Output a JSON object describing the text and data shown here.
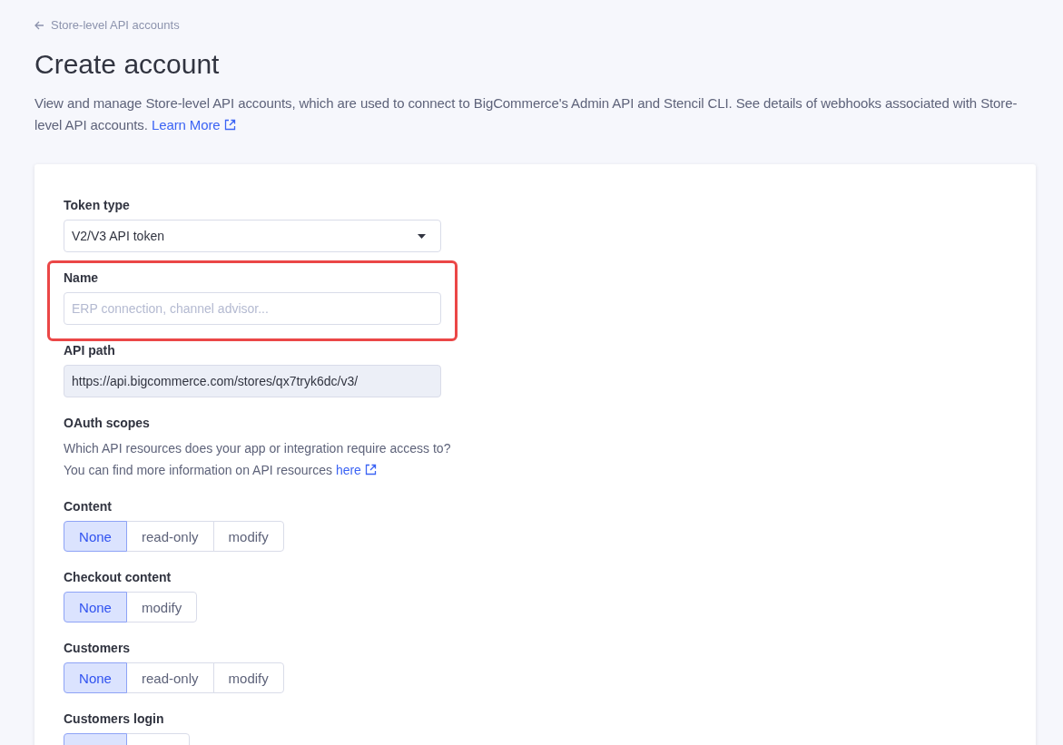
{
  "breadcrumb": {
    "label": "Store-level API accounts"
  },
  "title": "Create account",
  "description": {
    "text": "View and manage Store-level API accounts, which are used to connect to BigCommerce's Admin API and Stencil CLI. See details of webhooks associated with Store-level API accounts.",
    "link": "Learn More"
  },
  "token_type": {
    "label": "Token type",
    "value": "V2/V3 API token"
  },
  "name": {
    "label": "Name",
    "placeholder": "ERP connection, channel advisor...",
    "highlighted": true
  },
  "api_path": {
    "label": "API path",
    "value": "https://api.bigcommerce.com/stores/qx7tryk6dc/v3/"
  },
  "oauth": {
    "label": "OAuth scopes",
    "help": "Which API resources does your app or integration require access to?",
    "help_2": "You can find more information on API resources",
    "link": "here"
  },
  "scopes": [
    {
      "label": "Content",
      "options": [
        {
          "label": "None",
          "selected": true
        },
        {
          "label": "read-only",
          "selected": false
        },
        {
          "label": "modify",
          "selected": false
        }
      ]
    },
    {
      "label": "Checkout content",
      "options": [
        {
          "label": "None",
          "selected": true
        },
        {
          "label": "modify",
          "selected": false
        }
      ]
    },
    {
      "label": "Customers",
      "options": [
        {
          "label": "None",
          "selected": true
        },
        {
          "label": "read-only",
          "selected": false
        },
        {
          "label": "modify",
          "selected": false
        }
      ]
    },
    {
      "label": "Customers login",
      "options": [
        {
          "selected": true
        },
        {
          "selected": false
        }
      ]
    }
  ]
}
